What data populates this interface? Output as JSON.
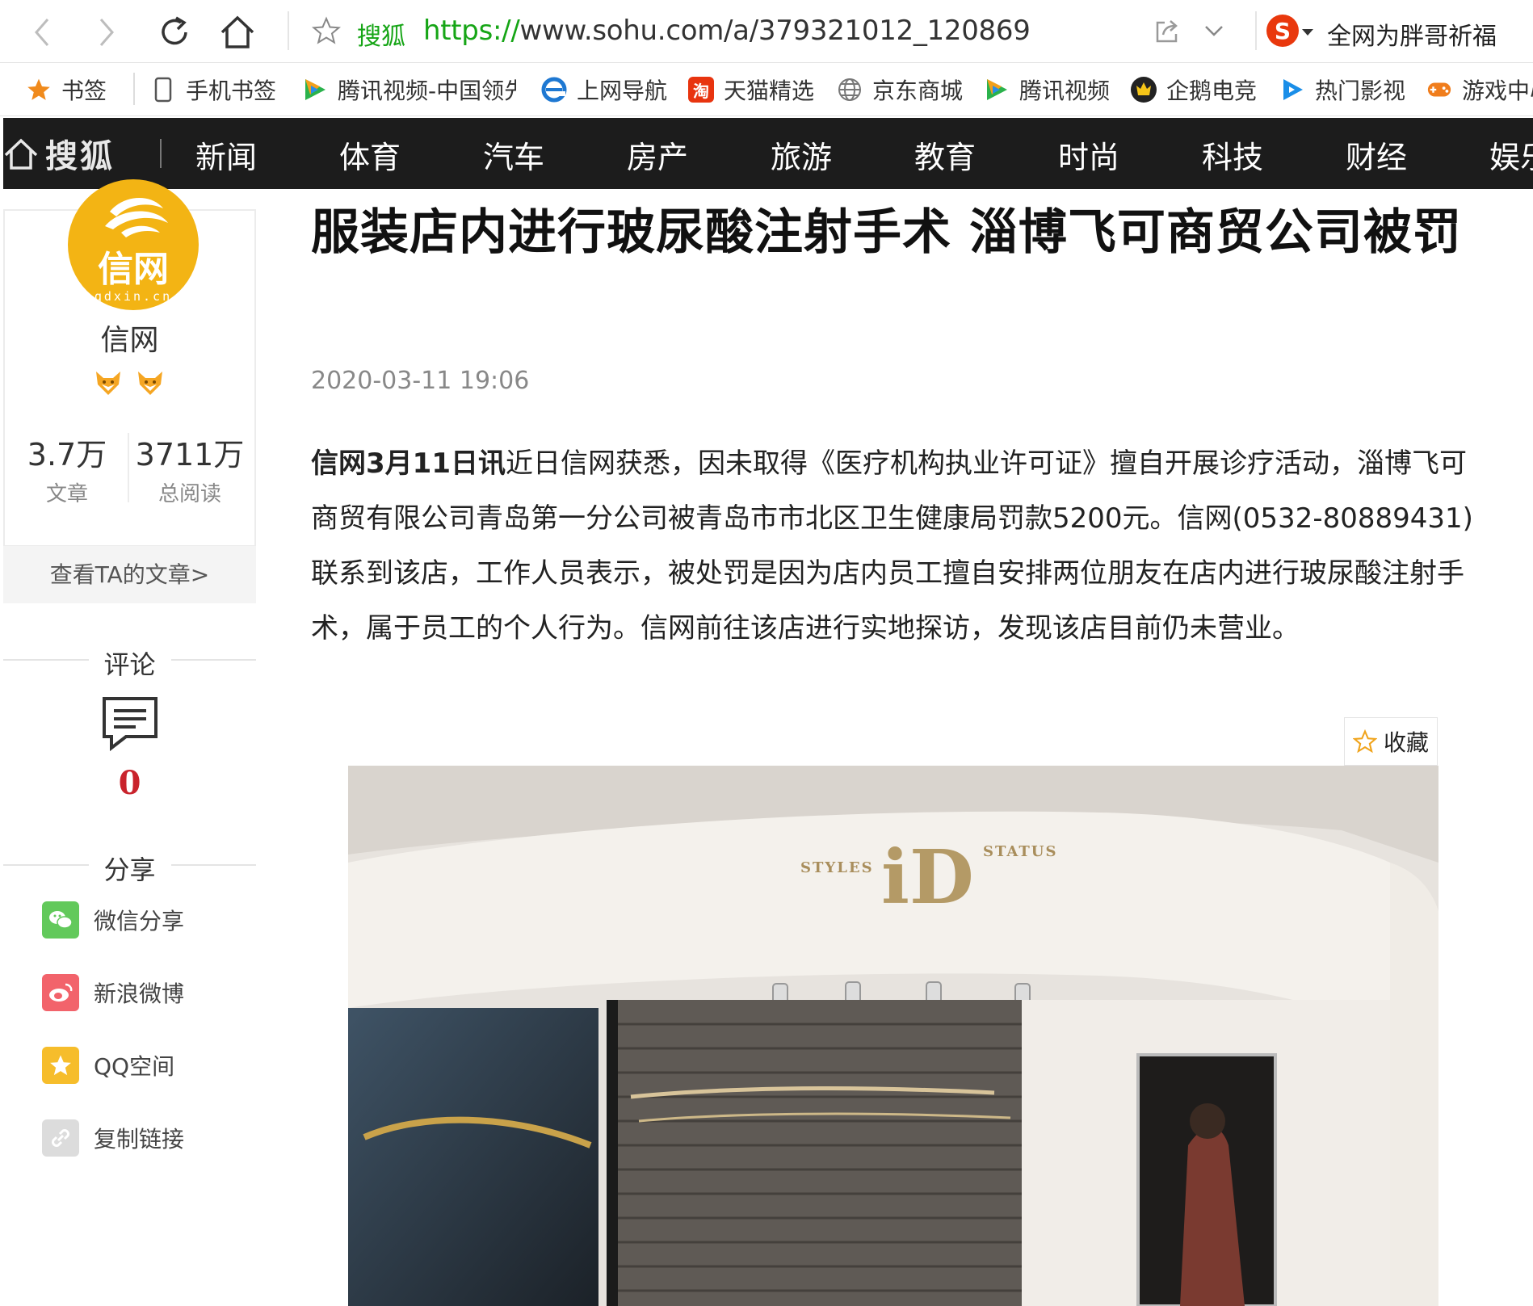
{
  "browser": {
    "site_name": "搜狐",
    "url_protocol": "https://",
    "url_rest": "www.sohu.com/a/379321012_120869",
    "search_hint": "全网为胖哥祈福"
  },
  "bookmarks": [
    {
      "label": "书签",
      "icon": "star-icon"
    },
    {
      "label": "手机书签",
      "icon": "phone-icon"
    },
    {
      "label": "腾讯视频-中国领先",
      "icon": "tencent-video-icon"
    },
    {
      "label": "上网导航",
      "icon": "ie-icon"
    },
    {
      "label": "天猫精选",
      "icon": "taobao-icon"
    },
    {
      "label": "京东商城",
      "icon": "globe-icon"
    },
    {
      "label": "腾讯视频",
      "icon": "tencent-video-icon"
    },
    {
      "label": "企鹅电竞",
      "icon": "esports-icon"
    },
    {
      "label": "热门影视",
      "icon": "play-icon"
    },
    {
      "label": "游戏中心",
      "icon": "gamepad-icon"
    }
  ],
  "sohu_nav": {
    "logo_text": "搜狐",
    "items": [
      "新闻",
      "体育",
      "汽车",
      "房产",
      "旅游",
      "教育",
      "时尚",
      "科技",
      "财经",
      "娱乐"
    ]
  },
  "author": {
    "avatar_main": "信网",
    "avatar_domain": "qdxin.cn",
    "name": "信网",
    "articles_count": "3.7万",
    "articles_label": "文章",
    "reads_count": "3711万",
    "reads_label": "总阅读",
    "view_articles": "查看TA的文章>"
  },
  "comments": {
    "title": "评论",
    "count": "0"
  },
  "share": {
    "title": "分享",
    "items": [
      {
        "label": "微信分享",
        "icon": "wechat-icon",
        "color": "#62c95b"
      },
      {
        "label": "新浪微博",
        "icon": "weibo-icon",
        "color": "#f2636b"
      },
      {
        "label": "QQ空间",
        "icon": "qzone-icon",
        "color": "#f6bd2b"
      },
      {
        "label": "复制链接",
        "icon": "link-icon",
        "color": "#dcdcdc"
      }
    ]
  },
  "article": {
    "title": "服装店内进行玻尿酸注射手术 淄博飞可商贸公司被罚",
    "date": "2020-03-11 19:06",
    "lead": "信网3月11日讯",
    "body": "近日信网获悉，因未取得《医疗机构执业许可证》擅自开展诊疗活动，淄博飞可商贸有限公司青岛第一分公司被青岛市市北区卫生健康局罚款5200元。信网(0532-80889431)联系到该店，工作人员表示，被处罚是因为店内员工擅自安排两位朋友在店内进行玻尿酸注射手术，属于员工的个人行为。信网前往该店进行实地探访，发现该店目前仍未营业。",
    "favorite_label": "收藏",
    "photo_sign_left": "STYLES",
    "photo_sign_center": "iD",
    "photo_sign_right": "STATUS"
  },
  "colors": {
    "accent_green": "#16a516",
    "nav_bg": "#1c1c1c",
    "comment_red": "#c9232c",
    "avatar_yellow": "#f3b414"
  }
}
